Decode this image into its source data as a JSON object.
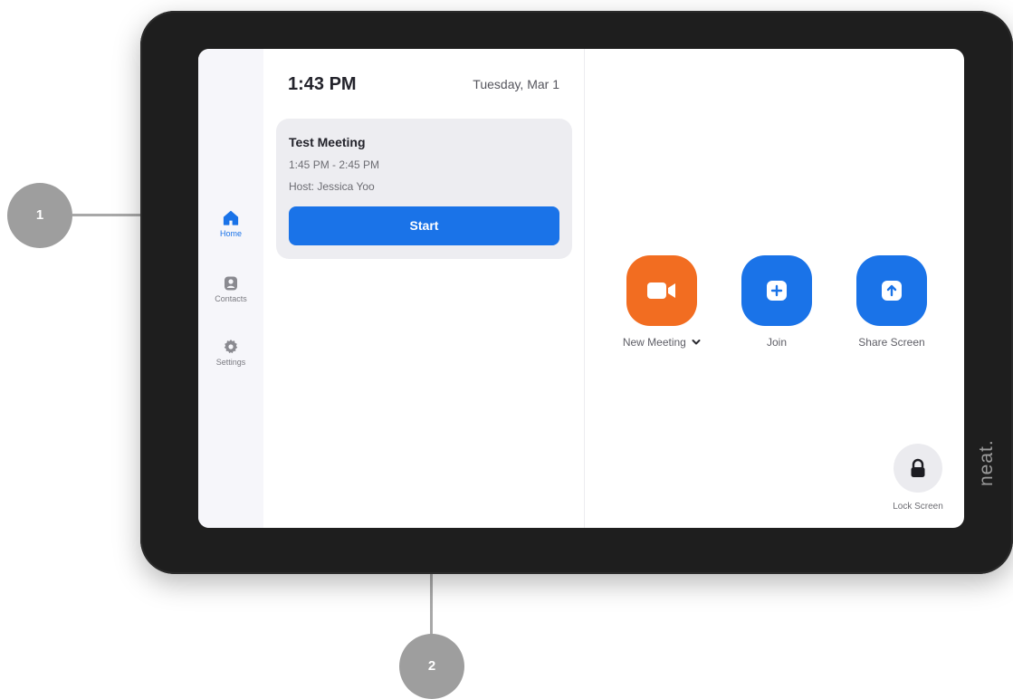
{
  "sidebar": {
    "items": [
      {
        "label": "Home",
        "icon": "home-icon",
        "active": true
      },
      {
        "label": "Contacts",
        "icon": "contacts-icon",
        "active": false
      },
      {
        "label": "Settings",
        "icon": "gear-icon",
        "active": false
      }
    ]
  },
  "header": {
    "time": "1:43 PM",
    "date": "Tuesday, Mar 1"
  },
  "meeting": {
    "title": "Test Meeting",
    "time": "1:45 PM - 2:45 PM",
    "host": "Host: Jessica Yoo",
    "start_label": "Start"
  },
  "actions": [
    {
      "label": "New Meeting",
      "icon": "video-camera-icon",
      "color": "#f26d21"
    },
    {
      "label": "Join",
      "icon": "plus-icon",
      "color": "#1a73e8"
    },
    {
      "label": "Share Screen",
      "icon": "upload-arrow-icon",
      "color": "#1a73e8"
    }
  ],
  "lock": {
    "label": "Lock Screen",
    "icon": "lock-icon"
  },
  "brand": "neat.",
  "callouts": [
    "1",
    "2"
  ],
  "colors": {
    "accent": "#1a73e8",
    "orange": "#f26d21",
    "callout": "#9e9e9e"
  }
}
